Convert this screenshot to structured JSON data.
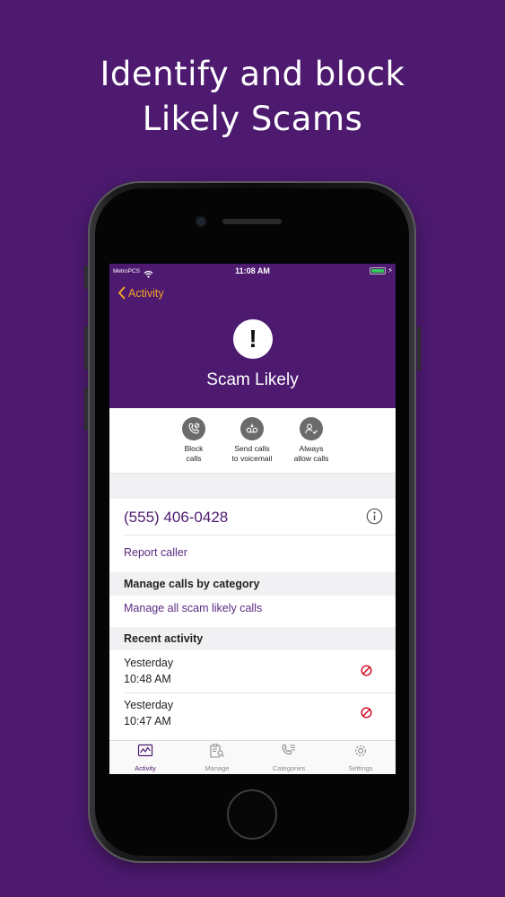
{
  "headline": {
    "line1": "Identify and block",
    "line2": "Likely Scams"
  },
  "status_bar": {
    "carrier": "MetroPCS",
    "time": "11:08 AM",
    "battery_color": "#35c759"
  },
  "nav": {
    "back_label": "Activity"
  },
  "caller": {
    "name": "Scam Likely",
    "alert_symbol": "!",
    "phone_number": "(555) 406-0428"
  },
  "actions": [
    {
      "label": "Block\ncalls",
      "icon": "phone-block-icon"
    },
    {
      "label": "Send calls\nto voicemail",
      "icon": "voicemail-icon"
    },
    {
      "label": "Always\nallow calls",
      "icon": "allow-user-icon"
    }
  ],
  "report_caller": "Report caller",
  "manage_section": {
    "header": "Manage calls by category",
    "link": "Manage all scam likely calls"
  },
  "recent_activity": {
    "header": "Recent activity",
    "items": [
      {
        "day": "Yesterday",
        "time": "10:48 AM",
        "status_icon": "blocked-icon"
      },
      {
        "day": "Yesterday",
        "time": "10:47 AM",
        "status_icon": "blocked-icon"
      }
    ]
  },
  "tabs": [
    {
      "label": "Activity",
      "icon": "activity-chart-icon",
      "active": true
    },
    {
      "label": "Manage",
      "icon": "clipboard-search-icon",
      "active": false
    },
    {
      "label": "Categories",
      "icon": "phone-list-icon",
      "active": false
    },
    {
      "label": "Settings",
      "icon": "gear-icon",
      "active": false
    }
  ],
  "colors": {
    "brand_purple": "#4d1a70",
    "back_orange": "#f5a623",
    "block_red": "#d0021b"
  }
}
